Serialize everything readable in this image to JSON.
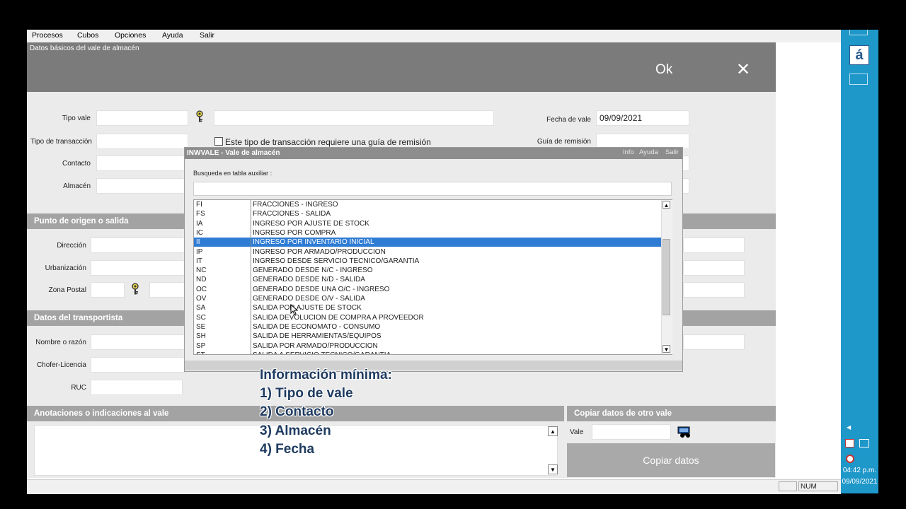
{
  "menu": [
    "Procesos",
    "Cubos",
    "Opciones",
    "Ayuda",
    "Salir"
  ],
  "form": {
    "title": "Datos básicos del vale de almacén",
    "ok": "Ok",
    "close": "✕",
    "tipo_vale_label": "Tipo vale",
    "tipo_transaccion_label": "Tipo de transacción",
    "contacto_label": "Contacto",
    "almacen_label": "Almacén",
    "checkbox_label": "Este tipo de transacción requiere una guía de remisión",
    "fecha_label": "Fecha de vale",
    "fecha_value": "09/09/2021",
    "guia_label": "Guía de remisión"
  },
  "origen": {
    "header": "Punto de origen o salida",
    "direccion_label": "Dirección",
    "urbanizacion_label": "Urbanización",
    "zona_label": "Zona Postal"
  },
  "transportista": {
    "header": "Datos del transportista",
    "nombre_label": "Nombre o razón",
    "chofer_label": "Chofer-Licencia",
    "ruc_label": "RUC"
  },
  "notes": {
    "header": "Anotaciones o indicaciones al vale"
  },
  "copy": {
    "header": "Copiar datos de otro vale",
    "vale_label": "Vale",
    "button": "Copiar datos"
  },
  "popup": {
    "title": "INWVALE - Vale de almacén",
    "menu": [
      "Info",
      "Ayuda",
      "Salir"
    ],
    "search_label": "Busqueda en tabla auxiliar :",
    "selected_index": 4,
    "rows": [
      {
        "code": "FI",
        "desc": "FRACCIONES - INGRESO"
      },
      {
        "code": "FS",
        "desc": "FRACCIONES - SALIDA"
      },
      {
        "code": "IA",
        "desc": "INGRESO POR AJUSTE DE STOCK"
      },
      {
        "code": "IC",
        "desc": "INGRESO POR COMPRA"
      },
      {
        "code": "II",
        "desc": "INGRESO POR INVENTARIO INICIAL"
      },
      {
        "code": "IP",
        "desc": "INGRESO POR ARMADO/PRODUCCION"
      },
      {
        "code": "IT",
        "desc": "INGRESO DESDE SERVICIO TECNICO/GARANTIA"
      },
      {
        "code": "NC",
        "desc": "GENERADO DESDE N/C - INGRESO"
      },
      {
        "code": "ND",
        "desc": "GENERADO DESDE N/D - SALIDA"
      },
      {
        "code": "OC",
        "desc": "GENERADO DESDE UNA O/C - INGRESO"
      },
      {
        "code": "OV",
        "desc": "GENERADO DESDE O/V - SALIDA"
      },
      {
        "code": "SA",
        "desc": "SALIDA POR AJUSTE DE STOCK"
      },
      {
        "code": "SC",
        "desc": "SALIDA DEVOLUCION DE COMPRA A PROVEEDOR"
      },
      {
        "code": "SE",
        "desc": "SALIDA DE ECONOMATO - CONSUMO"
      },
      {
        "code": "SH",
        "desc": "SALIDA DE HERRAMIENTAS/EQUIPOS"
      },
      {
        "code": "SP",
        "desc": "SALIDA POR ARMADO/PRODUCCION"
      },
      {
        "code": "ST",
        "desc": "SALIDA A SERVICIO TECNICO/GARANTIA"
      }
    ]
  },
  "overlay": [
    "Información mínima:",
    "1) Tipo de vale",
    "2) Contacto",
    "3) Almacén",
    "4) Fecha"
  ],
  "status": {
    "num": "NUM"
  },
  "tray": {
    "time": "04:42 p.m.",
    "date": "09/09/2021",
    "app_letter": "á"
  }
}
